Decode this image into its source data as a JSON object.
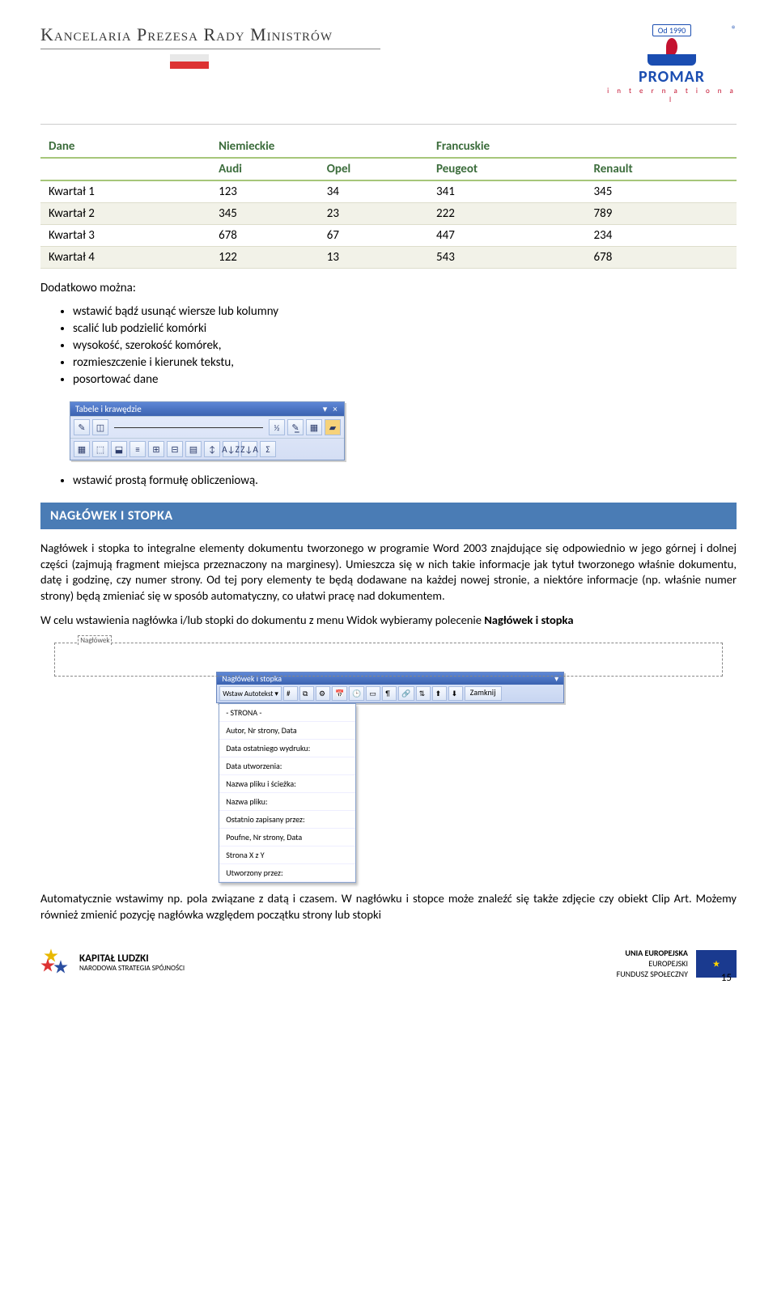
{
  "header": {
    "org_title": "Kancelaria Prezesa Rady Ministrów",
    "promar_since": "Od 1990",
    "promar_reg": "®",
    "promar_name": "PROMAR",
    "promar_intl": "i n t e r n a t i o n a l"
  },
  "chart_data": {
    "type": "table",
    "title": "",
    "top_header": [
      {
        "label": "Dane",
        "span": 1
      },
      {
        "label": "Niemieckie",
        "span": 2
      },
      {
        "label": "Francuskie",
        "span": 2
      }
    ],
    "sub_header": [
      "",
      "Audi",
      "Opel",
      "Peugeot",
      "Renault"
    ],
    "rows": [
      {
        "label": "Kwartał 1",
        "values": [
          123,
          34,
          341,
          345
        ]
      },
      {
        "label": "Kwartał 2",
        "values": [
          345,
          23,
          222,
          789
        ]
      },
      {
        "label": "Kwartał 3",
        "values": [
          678,
          67,
          447,
          234
        ]
      },
      {
        "label": "Kwartał 4",
        "values": [
          122,
          13,
          543,
          678
        ]
      }
    ]
  },
  "text": {
    "lead": "Dodatkowo można:",
    "bullets1": [
      "wstawić bądź usunąć wiersze lub kolumny",
      "scalić lub podzielić komórki",
      "wysokość, szerokość komórek,",
      "rozmieszczenie i kierunek tekstu,",
      "posortować dane"
    ],
    "bullets2": [
      "wstawić prostą formułę obliczeniową."
    ],
    "section_header": "NAGŁÓWEK I STOPKA",
    "para1": "Nagłówek i stopka to integralne elementy dokumentu tworzonego w programie Word 2003 znajdujące się odpowiednio w jego górnej i dolnej części (zajmują fragment miejsca przeznaczony na marginesy). Umieszcza się w nich takie informacje jak tytuł tworzonego właśnie dokumentu, datę i godzinę, czy numer strony. Od tej pory elementy te będą dodawane na każdej nowej stronie, a niektóre informacje (np. właśnie numer strony) będą zmieniać się w sposób automatyczny, co ułatwi pracę nad dokumentem.",
    "para2_a": "W celu wstawienia nagłówka i/lub stopki do dokumentu z menu Widok wybieramy polecenie ",
    "para2_b": "Nagłówek i stopka",
    "para3": "Automatycznie wstawimy np. pola związane z datą i czasem. W nagłówku i stopce może znaleźć się także zdjęcie czy obiekt Clip Art. Możemy również zmienić pozycję nagłówka względem początku strony lub stopki"
  },
  "toolbar": {
    "title": "Tabele i krawędzie",
    "close_symbol": "×",
    "min_symbol": "▾",
    "fraction": "½",
    "sort_az": "A↓Z",
    "sort_za": "Z↓A",
    "sigma": "Σ"
  },
  "hf": {
    "frame_label": "Nagłówek",
    "tb_title": "Nagłówek i stopka",
    "autotext_btn": "Wstaw Autotekst ▾",
    "close_btn": "Zamknij",
    "menu": [
      "- STRONA -",
      "Autor, Nr strony, Data",
      "Data ostatniego wydruku:",
      "Data utworzenia:",
      "Nazwa pliku i ścieżka:",
      "Nazwa pliku:",
      "Ostatnio zapisany przez:",
      "Poufne, Nr strony, Data",
      "Strona X z Y",
      "Utworzony przez:"
    ]
  },
  "footer": {
    "kl_big": "KAPITAŁ LUDZKI",
    "kl_small": "NARODOWA STRATEGIA SPÓJNOŚCI",
    "ue_l1": "UNIA EUROPEJSKA",
    "ue_l2": "EUROPEJSKI",
    "ue_l3": "FUNDUSZ SPOŁECZNY",
    "page_num": "15"
  }
}
